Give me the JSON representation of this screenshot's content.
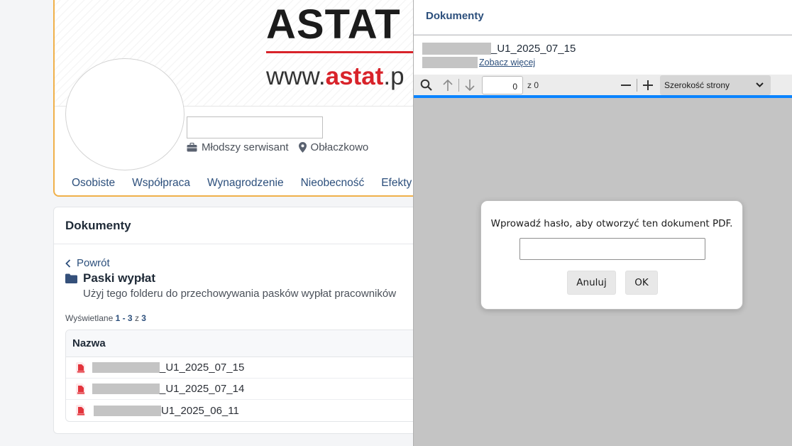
{
  "profile": {
    "logo_text": "ASTAT",
    "logo_url_prefix": "www.",
    "logo_url_accent": "astat",
    "logo_url_suffix": ".p",
    "role": "Młodszy serwisant",
    "location": "Obłaczkowo",
    "tabs": [
      "Osobiste",
      "Współpraca",
      "Wynagrodzenie",
      "Nieobecność",
      "Efekty"
    ]
  },
  "documents": {
    "header": "Dokumenty",
    "back_label": "Powrót",
    "folder_title": "Paski wypłat",
    "folder_desc": "Użyj tego folderu do przechowywania pasków wypłat pracowników",
    "count_prefix": "Wyświetlane ",
    "count_range": "1 - 3",
    "count_mid": " z ",
    "count_total": "3",
    "column_name": "Nazwa",
    "rows": [
      {
        "name_suffix": "_U1_2025_07_15"
      },
      {
        "name_suffix": "_U1_2025_07_14"
      },
      {
        "name_suffix": "U1_2025_06_11"
      }
    ]
  },
  "pdf_panel": {
    "title": "Dokumenty",
    "file_name_suffix": "_U1_2025_07_15",
    "see_more": "Zobacz więcej",
    "toolbar": {
      "page_value": "0",
      "page_of": "z 0",
      "zoom_label": "Szerokość strony"
    },
    "dialog": {
      "message": "Wprowadź hasło, aby otworzyć ten dokument PDF.",
      "cancel": "Anuluj",
      "ok": "OK"
    }
  },
  "colors": {
    "accent_orange": "#f0b04a",
    "link_blue": "#2c4f7c",
    "logo_red": "#d8232a",
    "pdf_progress": "#0a84ff"
  }
}
